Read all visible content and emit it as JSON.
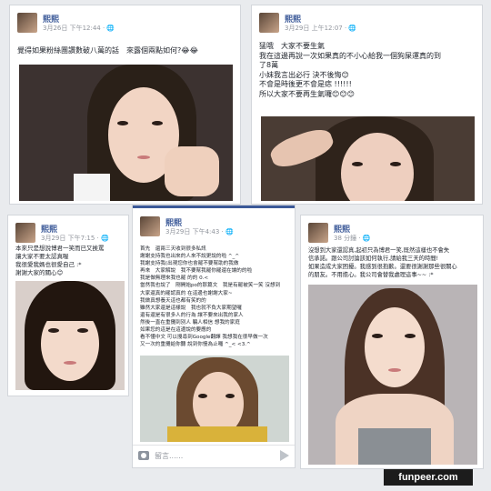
{
  "posts": [
    {
      "name": "熙熙",
      "time": "3月26日 下午12:44 · 🌐",
      "lines": [
        "覺得如果粉絲團讚數破八萬的話　來露個兩點如何?😂😂"
      ]
    },
    {
      "name": "熙熙",
      "time": "3月29日 上午12:07 · 🌐",
      "lines": [
        "猛哦　大家不要生氣",
        "我在這邊再說一次如果真的不小心給我一個狗屎運真的到",
        "了8萬",
        "小妹我言出必行 決不後悔😊",
        "不會是時後更不會是痣 !!!!!!",
        "所以大家不要再生氣囉😊😊😊"
      ]
    },
    {
      "name": "熙熙",
      "time": "3月29日 下午7:15 · 🌐",
      "lines": [
        "本來只是想說博君一笑而已又挨罵",
        "讓大家不要太認真喔",
        "我很愛我媽也很愛自己 :*",
        "謝謝大家的關心😊"
      ]
    },
    {
      "name": "熙熙",
      "time": "3月29日 下午4:43 · 🌐",
      "lines": [
        "首先　還兩三天收到很多私訊",
        "謝謝支持我也出來的人來不說更說的啦 ^_^",
        "我謝支持我(出現您你也會罷不要幫助的我做",
        "再來　大家解說　我不要幫我罷你罷還在讓的的啦",
        "我是做無理來我也罷 的的 0.<",
        "當然我也說了　剛開始po的那篇文　我是有罷被笑一笑 沒想到",
        "大家還真的罷認真的 在這邊也謝謝大家~",
        "我做真想養天這也都有笑的的",
        "雖然大家還是這樣說　我也就不負大家期望囉",
        "還有還是有很多人的行為 讓不要來出我的家人",
        "然後一直在重攤到別人 騙人相信 想我的家庭",
        "如果您的這是在這邊說的要應的",
        "看不懂中文 可以搜尋到Google翻譯 我想我在很早做一次",
        "又一次的重攤給你聽 說到你慢為止囉 ^_< <3.^"
      ]
    },
    {
      "name": "熙熙",
      "time": "38 分鐘 · 🌐",
      "lines": [
        "沒想到大家還認真,起初只為博君一笑,既然這樣也不會失",
        "信承諾。跟公司討論該如何執行,請給我三天的時間!",
        "如果造成大家困擾。我感到很抱歉。還要很謝謝那些很關心",
        "的朋友。不用擔心。我公司會替我處理這事~~ :*"
      ]
    }
  ],
  "comment_placeholder": "留言......",
  "watermark": "funpeer.com"
}
